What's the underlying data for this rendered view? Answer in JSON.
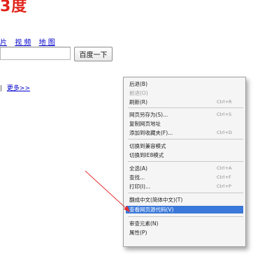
{
  "logo": {
    "text": "3度"
  },
  "nav": {
    "links": [
      "片",
      "视 频",
      "地 图"
    ]
  },
  "search": {
    "value": "",
    "button_label": "百度一下"
  },
  "more": {
    "separator": "|",
    "link": "更多>>"
  },
  "context_menu": {
    "items": [
      {
        "label": "后退(B)",
        "shortcut": "",
        "disabled": false,
        "highlighted": false
      },
      {
        "label": "前进(O)",
        "shortcut": "",
        "disabled": true,
        "highlighted": false
      },
      {
        "label": "刷新(R)",
        "shortcut": "Ctrl+R",
        "disabled": false,
        "highlighted": false
      },
      {
        "label": "网页另存为(S)...",
        "shortcut": "Ctrl+S",
        "disabled": false,
        "highlighted": false
      },
      {
        "label": "复制网页地址",
        "shortcut": "",
        "disabled": false,
        "highlighted": false
      },
      {
        "label": "添加到收藏夹(F)...",
        "shortcut": "Ctrl+D",
        "disabled": false,
        "highlighted": false
      },
      {
        "label": "切换到兼容模式",
        "shortcut": "",
        "disabled": false,
        "highlighted": false
      },
      {
        "label": "切换到IE8模式",
        "shortcut": "",
        "disabled": false,
        "highlighted": false
      },
      {
        "label": "全选(A)",
        "shortcut": "Ctrl+A",
        "disabled": false,
        "highlighted": false
      },
      {
        "label": "查找...",
        "shortcut": "Ctrl+F",
        "disabled": false,
        "highlighted": false
      },
      {
        "label": "打印(I)...",
        "shortcut": "Ctrl+P",
        "disabled": false,
        "highlighted": false
      },
      {
        "label": "翻成中文(简体中文)(T)",
        "shortcut": "",
        "disabled": false,
        "highlighted": false
      },
      {
        "label": "查看网页源代码(V)",
        "shortcut": "",
        "disabled": false,
        "highlighted": true
      },
      {
        "label": "审查元素(N)",
        "shortcut": "",
        "disabled": false,
        "highlighted": false
      },
      {
        "label": "属性(P)",
        "shortcut": "",
        "disabled": false,
        "highlighted": false
      }
    ]
  },
  "colors": {
    "brand_red": "#e1251b",
    "link_blue": "#0000cc",
    "highlight": "#3a78d9",
    "arrow": "#e53030"
  }
}
